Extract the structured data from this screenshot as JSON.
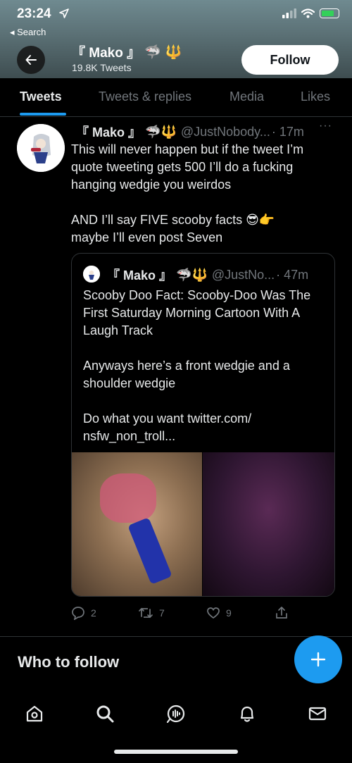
{
  "status_bar": {
    "time": "23:24",
    "back_label": "◂ Search"
  },
  "profile": {
    "name": "『 Mako 』",
    "tweets_count": "19.8K Tweets",
    "follow_label": "Follow"
  },
  "tabs": [
    {
      "label": "Tweets",
      "active": true
    },
    {
      "label": "Tweets & replies"
    },
    {
      "label": "Media"
    },
    {
      "label": "Likes"
    }
  ],
  "tweet": {
    "name": "『 Mako 』",
    "handle": "@JustNobody...",
    "time": "· 17m",
    "more": "···",
    "text": "This will never happen but if the tweet I’m quote tweeting gets 500 I’ll do a fucking hanging wedgie you weirdos\n\nAND I’ll say FIVE scooby facts 😎👉\nmaybe I’ll even post Seven",
    "quote": {
      "name": "『 Mako 』",
      "handle": "@JustNo...",
      "time": "· 47m",
      "text": "Scooby Doo Fact: Scooby-Doo Was The First Saturday Morning Cartoon With A Laugh Track\n\nAnyways here’s a front wedgie and a shoulder wedgie\n\nDo what you want twitter.com/\nnsfw_non_troll..."
    },
    "actions": {
      "replies": "2",
      "retweets": "7",
      "likes": "9"
    }
  },
  "who_to_follow": "Who to follow",
  "colors": {
    "accent": "#1d9bf0",
    "background": "#000000",
    "muted": "#71767b"
  },
  "bottom_nav": [
    "home-icon",
    "search-icon",
    "spaces-icon",
    "bell-icon",
    "mail-icon"
  ]
}
